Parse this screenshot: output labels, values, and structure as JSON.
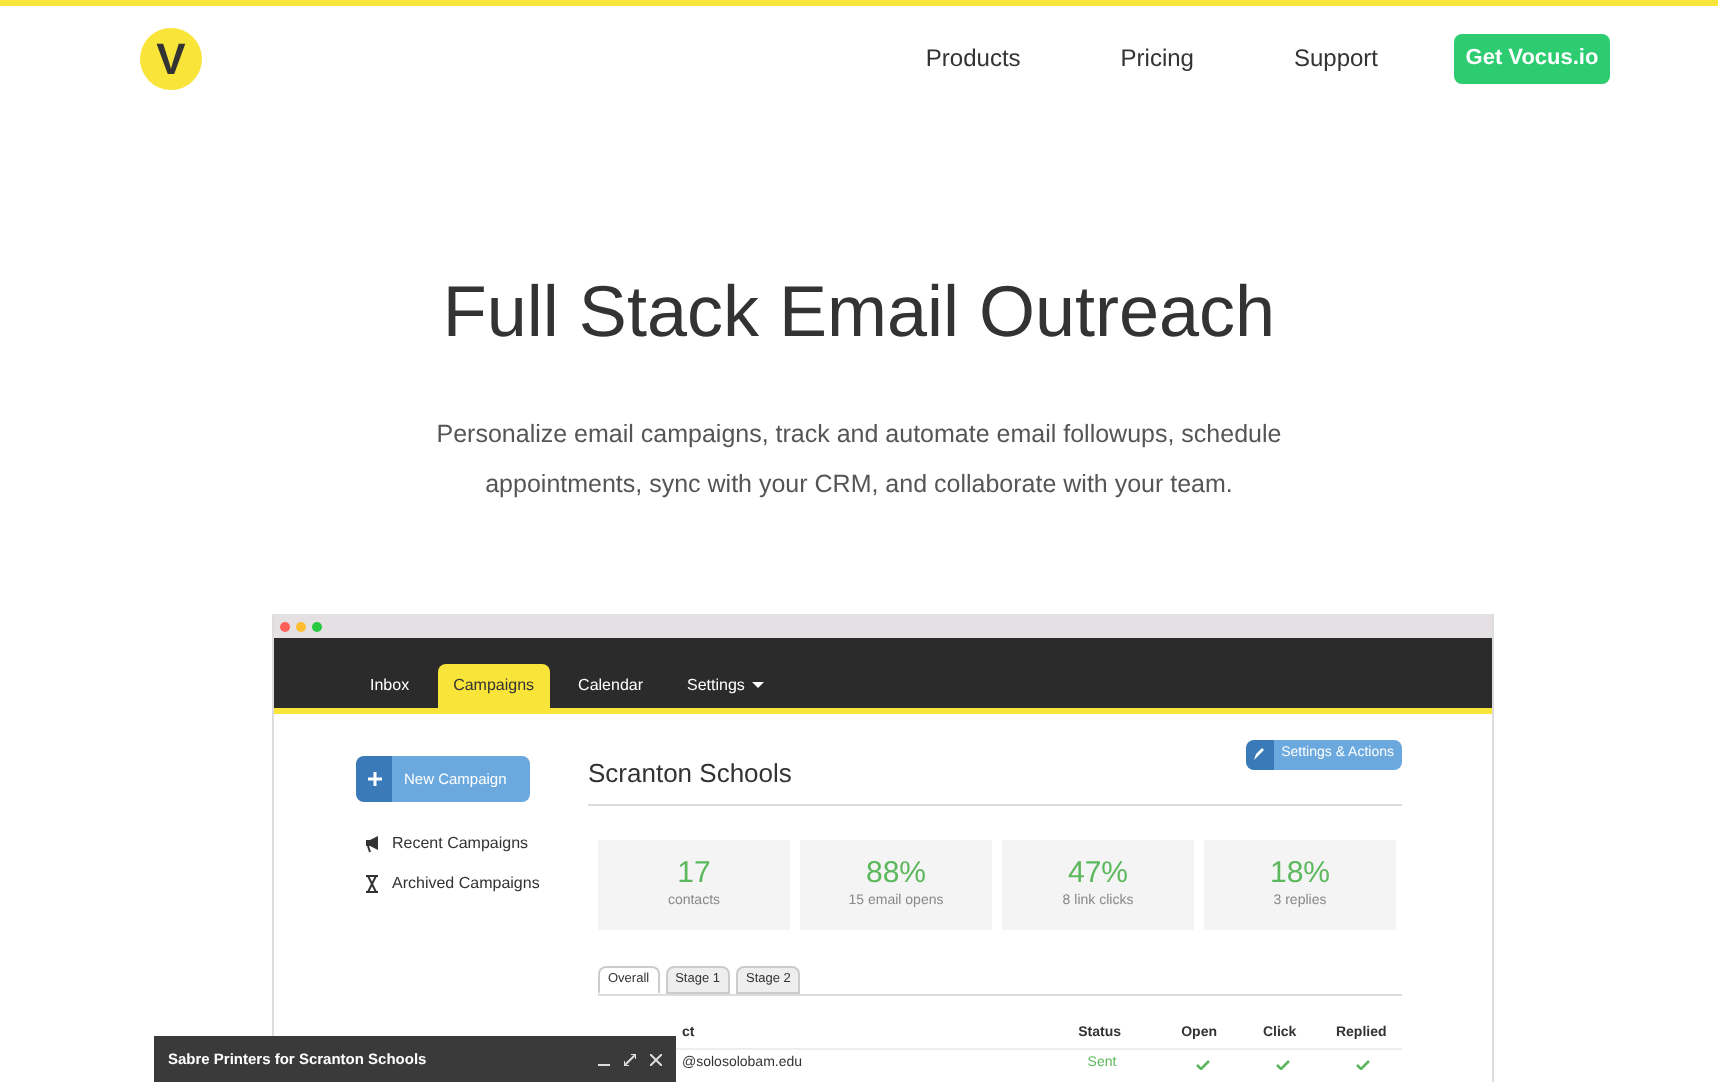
{
  "logo": {
    "letter": "V"
  },
  "nav": {
    "links": [
      "Products",
      "Pricing",
      "Support"
    ],
    "cta": "Get Vocus.io"
  },
  "hero": {
    "title": "Full Stack Email Outreach",
    "subtitle": "Personalize email campaigns, track and automate email followups, schedule appointments, sync with your CRM, and collaborate with your team."
  },
  "app": {
    "tabs": [
      {
        "label": "Inbox",
        "selected": false,
        "dropdown": false
      },
      {
        "label": "Campaigns",
        "selected": true,
        "dropdown": false
      },
      {
        "label": "Calendar",
        "selected": false,
        "dropdown": false
      },
      {
        "label": "Settings",
        "selected": false,
        "dropdown": true
      }
    ],
    "new_campaign": "New Campaign",
    "sidebar": [
      {
        "label": "Recent Campaigns",
        "kind": "megaphone"
      },
      {
        "label": "Archived Campaigns",
        "kind": "hourglass"
      }
    ],
    "campaign_title": "Scranton Schools",
    "settings_button": "Settings & Actions",
    "stats": [
      {
        "value": "17",
        "label": "contacts"
      },
      {
        "value": "88%",
        "label": "15 email opens"
      },
      {
        "value": "47%",
        "label": "8 link clicks"
      },
      {
        "value": "18%",
        "label": "3 replies"
      }
    ],
    "stage_tabs": [
      {
        "label": "Overall",
        "selected": true
      },
      {
        "label": "Stage 1",
        "selected": false
      },
      {
        "label": "Stage 2",
        "selected": false
      }
    ],
    "table": {
      "columns": [
        "ct",
        "Status",
        "Open",
        "Click",
        "Replied"
      ],
      "rows": [
        {
          "contact": "@solosolobam.edu",
          "status": "Sent",
          "open": true,
          "click": true,
          "replied": true
        }
      ]
    }
  },
  "compose": {
    "title": "Sabre Printers for Scranton Schools"
  }
}
